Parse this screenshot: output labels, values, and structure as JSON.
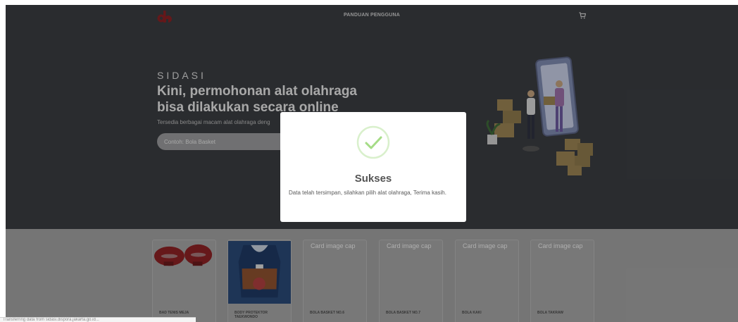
{
  "nav": {
    "logo_icon": "dh-logo-icon",
    "link_label": "PANDUAN PENGGUNA",
    "cart_icon": "cart-icon"
  },
  "hero": {
    "brand": "SIDASI",
    "headline_line1": "Kini, permohonan alat olahraga",
    "headline_line2": "bisa dilakukan secara online",
    "subtext": "Tersedia berbagai macam alat olahraga deng",
    "search_placeholder": "Contoh: Bola Basket",
    "illustration_icon": "delivery-illustration"
  },
  "products": [
    {
      "caption": "",
      "name": "BAD TENIS MEJA",
      "image": "table-tennis-bat-image"
    },
    {
      "caption": "",
      "name": "BODY PROTEKTOR TAEKWONDO",
      "image": "body-protector-image"
    },
    {
      "caption": "Card image cap",
      "name": "BOLA BASKET NO.6",
      "image": "placeholder"
    },
    {
      "caption": "Card image cap",
      "name": "BOLA BASKET NO.7",
      "image": "placeholder"
    },
    {
      "caption": "Card image cap",
      "name": "BOLA KAKI",
      "image": "placeholder"
    },
    {
      "caption": "Card image cap",
      "name": "BOLA TAKRAW",
      "image": "placeholder"
    }
  ],
  "modal": {
    "icon": "success-check-icon",
    "title": "Sukses",
    "message": "Data telah tersimpan, silahkan pilih alat olahraga, Terima kasih."
  },
  "toast": {
    "text": "Transferring data from sidasi.dispora.jakarta.go.id..."
  },
  "colors": {
    "logo": "#c0292b",
    "success": "#a5dc86",
    "hero_bg": "#3b3e42"
  }
}
